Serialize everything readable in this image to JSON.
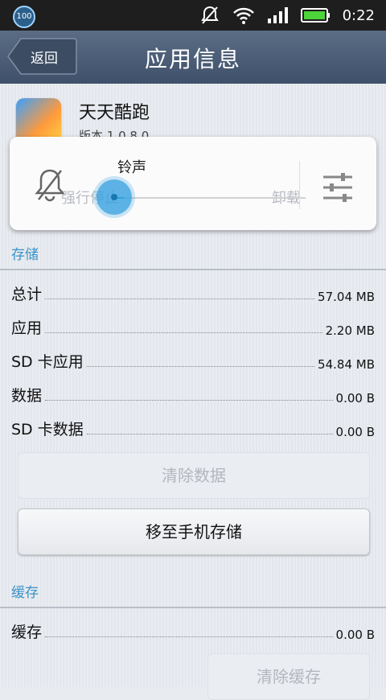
{
  "statusbar": {
    "badge": "100",
    "time": "0:22",
    "icons": [
      "notifications-muted-icon",
      "wifi-icon",
      "signal-icon",
      "battery-icon"
    ]
  },
  "titlebar": {
    "back_label": "返回",
    "title": "应用信息"
  },
  "app": {
    "name": "天天酷跑",
    "version": "版本 1.0.8.0"
  },
  "volume_popup": {
    "label": "铃声",
    "level": 0.06,
    "hidden_buttons": [
      "强行停止",
      "卸载"
    ]
  },
  "storage": {
    "header": "存储",
    "rows": [
      {
        "label": "总计",
        "value": "57.04 MB"
      },
      {
        "label": "应用",
        "value": "2.20 MB"
      },
      {
        "label": "SD 卡应用",
        "value": "54.84 MB"
      },
      {
        "label": "数据",
        "value": "0.00 B"
      },
      {
        "label": "SD 卡数据",
        "value": "0.00 B"
      }
    ],
    "clear_data": "清除数据",
    "move_button": "移至手机存储"
  },
  "cache": {
    "header": "缓存",
    "rows": [
      {
        "label": "缓存",
        "value": "0.00 B"
      }
    ],
    "clear_cache": "清除缓存"
  },
  "colors": {
    "accent": "#3a93c9",
    "titlebar": "#4a5b74",
    "thumb": "#35a0e0"
  }
}
